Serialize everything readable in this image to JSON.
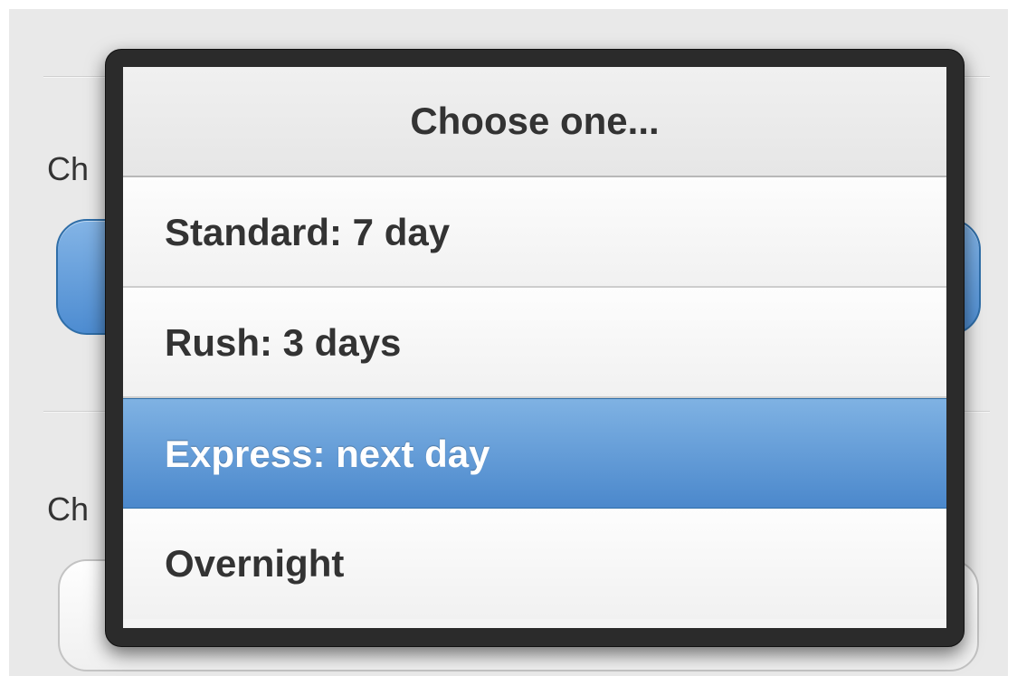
{
  "background_form": {
    "label_1": "Ch",
    "label_2": "Ch"
  },
  "picker": {
    "header": "Choose one...",
    "options": [
      {
        "label": "Standard: 7 day",
        "selected": false
      },
      {
        "label": "Rush: 3 days",
        "selected": false
      },
      {
        "label": "Express: next day",
        "selected": true
      },
      {
        "label": "Overnight",
        "selected": false
      }
    ]
  },
  "colors": {
    "selected_accent": "#5b96d4",
    "overlay_frame": "#2b2b2b"
  }
}
